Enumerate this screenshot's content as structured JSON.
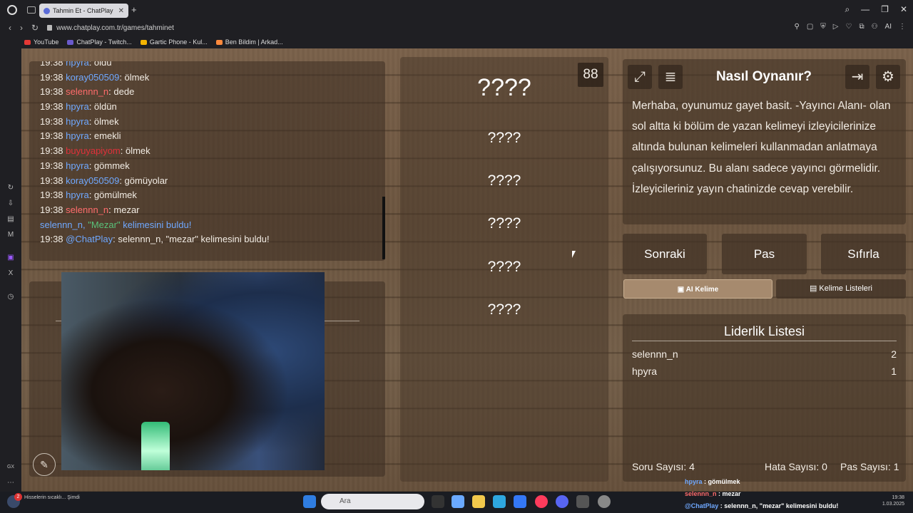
{
  "browser": {
    "tab_title": "Tahmin Et - ChatPlay",
    "url": "www.chatplay.com.tr/games/tahminet",
    "bookmarks": [
      {
        "label": "YouTube",
        "color": "#e53935"
      },
      {
        "label": "ChatPlay - Twitch...",
        "color": "#6a5acd"
      },
      {
        "label": "Gartic Phone - Kul...",
        "color": "#f5b400"
      },
      {
        "label": "Ben Bildim | Arkad...",
        "color": "#ff8a3d"
      }
    ],
    "ai_label": "AI"
  },
  "chat": {
    "lines": [
      {
        "time": "19:38",
        "user": "hpyra",
        "sep": ": ",
        "text": "öldü",
        "color": "#6fa8ff"
      },
      {
        "time": "19:38",
        "user": "koray050509",
        "sep": ": ",
        "text": "ölmek",
        "color": "#6fa8ff"
      },
      {
        "time": "19:38",
        "user": "selennn_n",
        "sep": ": ",
        "text": "dede",
        "color": "#ff6b6b"
      },
      {
        "time": "19:38",
        "user": "hpyra",
        "sep": ": ",
        "text": "öldün",
        "color": "#6fa8ff"
      },
      {
        "time": "19:38",
        "user": "hpyra",
        "sep": ": ",
        "text": "ölmek",
        "color": "#6fa8ff"
      },
      {
        "time": "19:38",
        "user": "hpyra",
        "sep": ": ",
        "text": "emekli",
        "color": "#6fa8ff"
      },
      {
        "time": "19:38",
        "user": "buyuyapiyom",
        "sep": ": ",
        "text": "ölmek",
        "color": "#e0303a"
      },
      {
        "time": "19:38",
        "user": "hpyra",
        "sep": ": ",
        "text": "gömmek",
        "color": "#6fa8ff"
      },
      {
        "time": "19:38",
        "user": "koray050509",
        "sep": ": ",
        "text": "gömüyolar",
        "color": "#6fa8ff"
      },
      {
        "time": "19:38",
        "user": "hpyra",
        "sep": ": ",
        "text": "gömülmek",
        "color": "#6fa8ff"
      },
      {
        "time": "19:38",
        "user": "selennn_n",
        "sep": ": ",
        "text": "mezar",
        "color": "#ff6b6b"
      }
    ],
    "system_line": {
      "user": "selennn_n",
      "sep": ", ",
      "word": "\"Mezar\"",
      "text": " kelimesini buldu!"
    },
    "bot_line": {
      "time": "19:38",
      "user": "@ChatPlay",
      "sep": ": ",
      "text": "selennn_n, \"mezar\" kelimesini buldu!"
    }
  },
  "game": {
    "timer": "88",
    "words": [
      "????",
      "????",
      "????",
      "????",
      "????",
      "????"
    ]
  },
  "how_to": {
    "title": "Nasıl Oynanır?",
    "text": "Merhaba, oyunumuz gayet basit. -Yayıncı Alanı- olan sol altta ki bölüm de yazan kelimeyi izleyicilerinize altında bulunan kelimeleri kullanmadan anlatmaya çalışıyorsunuz. Bu alanı sadece yayıncı görmelidir. İzleyicileriniz yayın chatinizde cevap verebilir."
  },
  "actions": {
    "next": "Sonraki",
    "pass": "Pas",
    "reset": "Sıfırla"
  },
  "tabs": {
    "ai": "AI Kelime",
    "lists": "Kelime Listeleri"
  },
  "leaderboard": {
    "title": "Liderlik Listesi",
    "rows": [
      {
        "name": "selennn_n",
        "score": "2"
      },
      {
        "name": "hpyra",
        "score": "1"
      }
    ]
  },
  "stats": {
    "questions": "Soru Sayısı: 4",
    "errors": "Hata Sayısı: 0",
    "passes": "Pas Sayısı: 1"
  },
  "taskbar": {
    "search_placeholder": "Ara",
    "notification": "Hisselerin sıcaklı... Şimdi",
    "badge": "2",
    "overlay": [
      {
        "user": "hpyra",
        "text": " : gömülmek",
        "color": "#6fa8ff"
      },
      {
        "user": "selennn_n",
        "text": " : mezar",
        "color": "#ff6b6b"
      },
      {
        "user": "@ChatPlay",
        "text": " : selennn_n, \"mezar\" kelimesini buldu!",
        "color": "#6fa8ff"
      }
    ],
    "clock_time": "19:38",
    "clock_date": "1.03.2025"
  }
}
